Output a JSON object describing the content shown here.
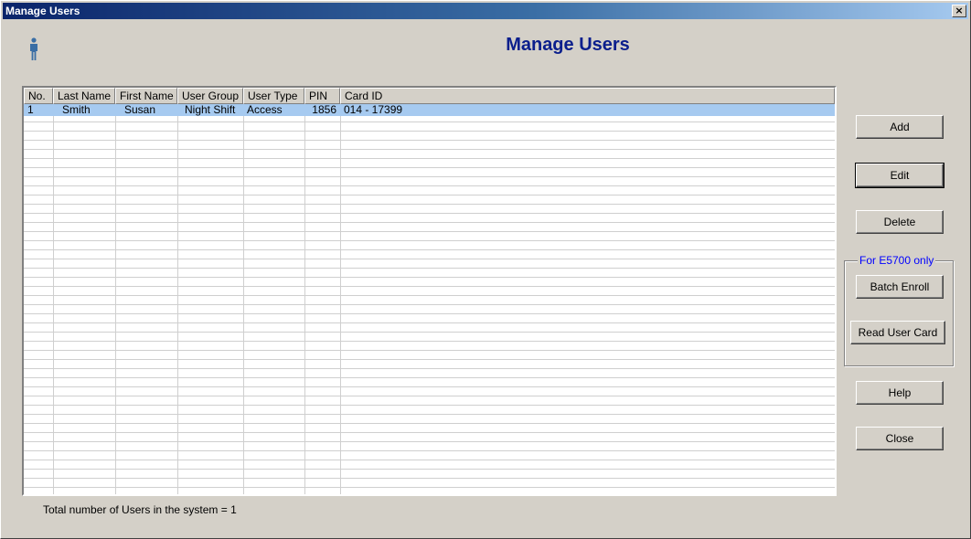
{
  "window": {
    "title": "Manage Users",
    "close_glyph": "×"
  },
  "header": {
    "heading": "Manage Users",
    "icon": "person-icon"
  },
  "table": {
    "columns": [
      "No.",
      "Last Name",
      "First Name",
      "User Group",
      "User Type",
      "PIN",
      "Card ID"
    ],
    "rows": [
      {
        "no": "1",
        "last_name": "Smith",
        "first_name": "Susan",
        "user_group": "Night Shift",
        "user_type": "Access",
        "pin": "1856",
        "card_id": "014 - 17399",
        "selected": true
      }
    ]
  },
  "buttons": {
    "add": "Add",
    "edit": "Edit",
    "delete": "Delete",
    "batch_enroll": "Batch Enroll",
    "read_user_card": "Read User Card",
    "help": "Help",
    "close": "Close"
  },
  "e5700_group": {
    "legend": "For E5700 only"
  },
  "status": {
    "total_users": "Total number of Users in the system = 1"
  },
  "colors": {
    "heading": "#0a1e8c",
    "selection": "#a6caf0",
    "legend": "#0000ff"
  }
}
